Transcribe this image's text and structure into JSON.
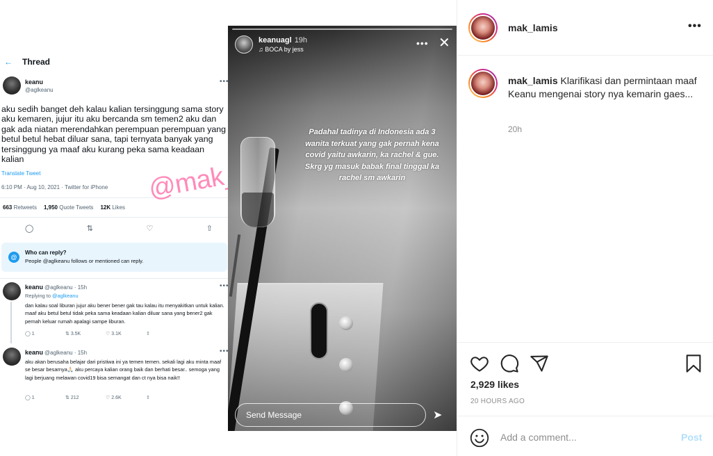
{
  "post": {
    "username": "mak_lamis",
    "more_label": "•••",
    "caption_text": "Klarifikasi dan permintaan maaf Keanu mengenai story nya kemarin gaes...",
    "caption_time": "20h",
    "likes": "2,929 likes",
    "date": "20 HOURS AGO",
    "comment_placeholder": "Add a comment...",
    "post_label": "Post",
    "colors": {
      "post_disabled": "#b2dffc",
      "muted": "#8e8e8e"
    }
  },
  "image": {
    "watermark": "@mak_lamis",
    "tweet": {
      "header": "Thread",
      "back": "←",
      "name": "keanu",
      "handle": "@aglkeanu",
      "more": "•••",
      "text": "aku sedih banget deh kalau kalian tersinggung sama story aku kemaren, jujur itu aku bercanda sm temen2 aku dan gak ada niatan merendahkan perempuan perempuan yang betul betul hebat diluar sana, tapi ternyata banyak yang tersinggung ya maaf aku kurang peka sama keadaan kalian",
      "translate": "Translate Tweet",
      "date": "6:10 PM · Aug 10, 2021 · Twitter for iPhone",
      "stats": {
        "retweets_num": "663",
        "retweets_label": "Retweets",
        "quotes_num": "1,950",
        "quotes_label": "Quote Tweets",
        "likes_num": "12K",
        "likes_label": "Likes"
      },
      "who_reply_title": "Who can reply?",
      "who_reply_sub": "People @aglkeanu follows or mentioned can reply.",
      "replies": [
        {
          "name": "keanu",
          "meta": "@aglkeanu · 15h",
          "replying": "Replying to",
          "replying_to": "@aglkeanu",
          "text": "dan kalau soal liburan jujur aku bener bener gak tau kalau itu menyakitkan untuk kalian. maaf aku betul betul tidak peka sama keadaan kalian diluar sana yang bener2 gak pernah keluar rumah apalagi sampe liburan.",
          "counts": [
            "1",
            "3.5K",
            "3.1K"
          ]
        },
        {
          "name": "keanu",
          "meta": "@aglkeanu · 15h",
          "text": "aku akan berusaha belajar dari pristiwa ini ya temen temen. sekali lagi aku minta maaf se besar besarnya🙏🏻 aku percaya kalian orang baik dan berhati besar.. semoga yang lagi berjuang melawan covid19 bisa semangat dan ct nya bisa naik!!",
          "counts": [
            "1",
            "212",
            "2.6K"
          ]
        }
      ]
    },
    "story": {
      "user": "keanuagl",
      "time": "19h",
      "music": "♫ BOCA by jess",
      "caption": "Padahal tadinya di Indonesia ada 3 wanita terkuat yang gak pernah kena covid yaitu awkarin, ka rachel & gue. Skrg yg masuk babak final tinggal ka rachel sm awkarin",
      "send_placeholder": "Send Message"
    }
  }
}
